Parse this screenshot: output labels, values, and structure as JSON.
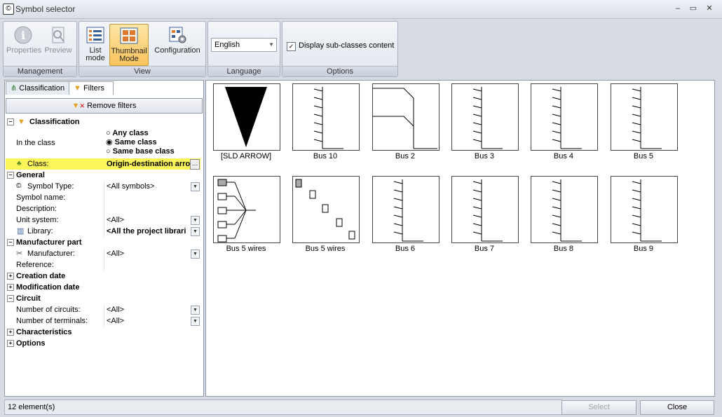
{
  "window": {
    "title": "Symbol selector"
  },
  "ribbon": {
    "groups": {
      "management": "Management",
      "view": "View",
      "language": "Language",
      "options": "Options"
    },
    "buttons": {
      "properties": "Properties",
      "preview": "Preview",
      "list_mode": [
        "List",
        "mode"
      ],
      "thumbnail_mode": [
        "Thumbnail",
        "Mode"
      ],
      "configuration": "Configuration"
    },
    "language_value": "English",
    "subclasses_label": "Display sub-classes content",
    "subclasses_checked": true
  },
  "tabs": {
    "classification": "Classification",
    "filters": "Filters"
  },
  "remove_filters": "Remove filters",
  "filters": {
    "classification": {
      "header": "Classification",
      "in_class_label": "In the class",
      "options": [
        "Any class",
        "Same class",
        "Same base class"
      ],
      "selected_option": "Same class",
      "class_label": "Class:",
      "class_value": "Origin-destination arro"
    },
    "general": {
      "header": "General",
      "symbol_type_label": "Symbol Type:",
      "symbol_type_value": "<All symbols>",
      "symbol_name_label": "Symbol name:",
      "description_label": "Description:",
      "unit_system_label": "Unit system:",
      "unit_system_value": "<All>",
      "library_label": "Library:",
      "library_value": "<All the project librari"
    },
    "manufacturer": {
      "header": "Manufacturer part",
      "manufacturer_label": "Manufacturer:",
      "manufacturer_value": "<All>",
      "reference_label": "Reference:"
    },
    "creation_date": "Creation date",
    "modification_date": "Modification date",
    "circuit": {
      "header": "Circuit",
      "circuits_label": "Number of circuits:",
      "circuits_value": "<All>",
      "terminals_label": "Number of terminals:",
      "terminals_value": "<All>"
    },
    "characteristics": "Characteristics",
    "options": "Options"
  },
  "symbols": [
    {
      "name": "[SLD ARROW]",
      "kind": "arrow"
    },
    {
      "name": "Bus 10",
      "kind": "bus"
    },
    {
      "name": "Bus 2",
      "kind": "bus2"
    },
    {
      "name": "Bus 3",
      "kind": "bus"
    },
    {
      "name": "Bus 4",
      "kind": "bus"
    },
    {
      "name": "Bus 5",
      "kind": "bus"
    },
    {
      "name": "Bus 5 wires",
      "kind": "fan"
    },
    {
      "name": "Bus 5 wires",
      "kind": "stairs"
    },
    {
      "name": "Bus 6",
      "kind": "bus"
    },
    {
      "name": "Bus 7",
      "kind": "bus"
    },
    {
      "name": "Bus 8",
      "kind": "bus"
    },
    {
      "name": "Bus 9",
      "kind": "bus"
    }
  ],
  "status": {
    "count": "12 element(s)"
  },
  "footer": {
    "select": "Select",
    "close": "Close"
  }
}
